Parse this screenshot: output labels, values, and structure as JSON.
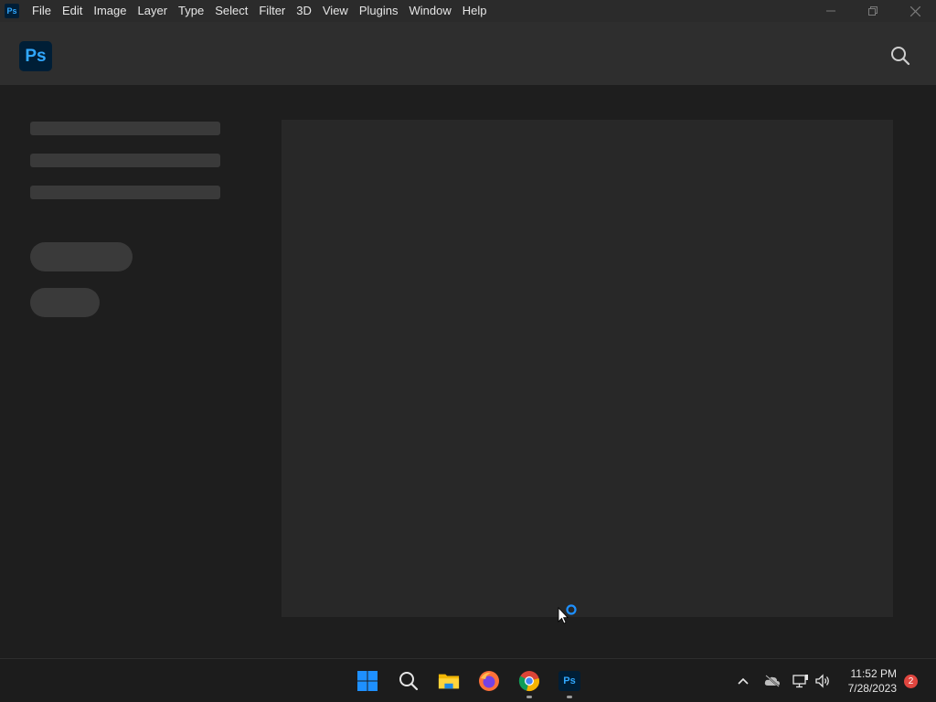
{
  "app": {
    "mini_icon_text": "Ps",
    "logo_text": "Ps"
  },
  "menu": {
    "items": [
      {
        "label": "File"
      },
      {
        "label": "Edit"
      },
      {
        "label": "Image"
      },
      {
        "label": "Layer"
      },
      {
        "label": "Type"
      },
      {
        "label": "Select"
      },
      {
        "label": "Filter"
      },
      {
        "label": "3D"
      },
      {
        "label": "View"
      },
      {
        "label": "Plugins"
      },
      {
        "label": "Window"
      },
      {
        "label": "Help"
      }
    ]
  },
  "window_controls": {
    "minimize": "—",
    "restore": "❐",
    "close": "✕"
  },
  "header": {
    "search_icon": "search-icon"
  },
  "taskbar": {
    "apps": [
      {
        "name": "start-icon"
      },
      {
        "name": "search-icon"
      },
      {
        "name": "file-explorer-icon"
      },
      {
        "name": "firefox-icon"
      },
      {
        "name": "chrome-icon"
      },
      {
        "name": "photoshop-icon",
        "label": "Ps"
      }
    ],
    "tray": {
      "time": "11:52 PM",
      "date": "7/28/2023",
      "notification_count": "2"
    }
  },
  "colors": {
    "accent": "#31a8ff",
    "ps_bg": "#001e36",
    "badge": "#e0463f"
  }
}
